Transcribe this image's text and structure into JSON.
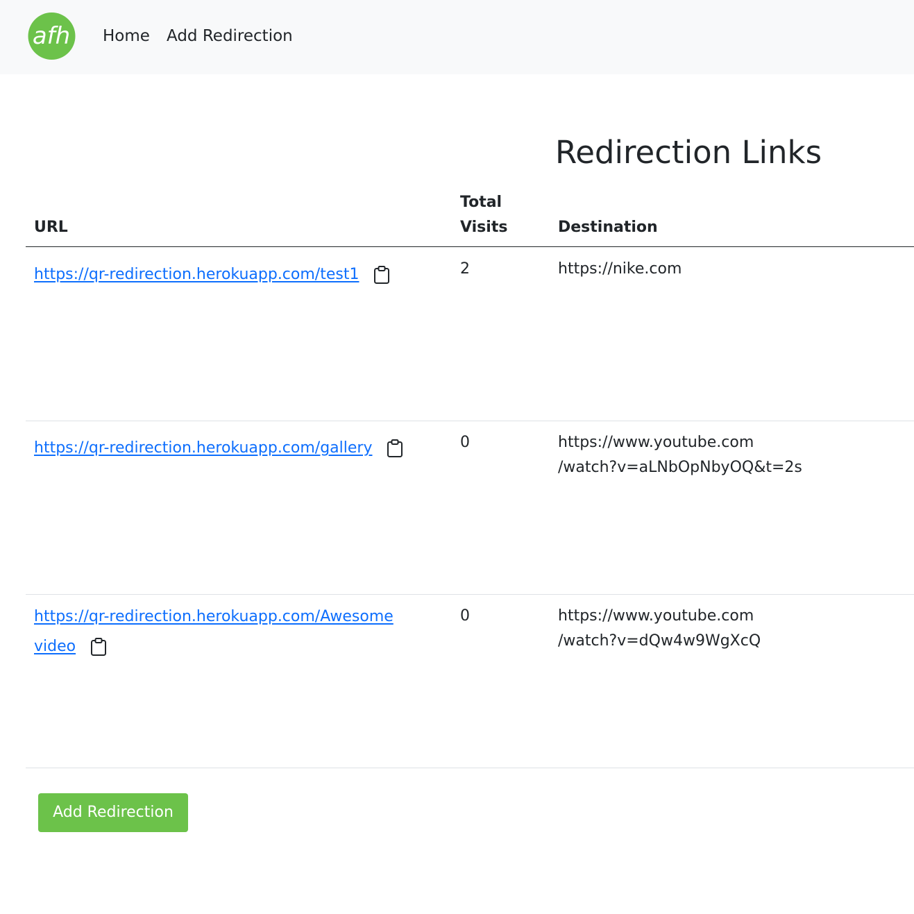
{
  "nav": {
    "logo_text": "afh",
    "home_label": "Home",
    "add_label": "Add Redirection"
  },
  "main": {
    "title": "Redirection Links",
    "columns": {
      "url": "URL",
      "visits_line1": "Total",
      "visits_line2": "Visits",
      "destination": "Destination"
    },
    "rows": [
      {
        "url": "https://qr-redirection.herokuapp.com/test1",
        "visits": "2",
        "destination": "https://nike.com"
      },
      {
        "url": "https://qr-redirection.herokuapp.com/gallery",
        "visits": "0",
        "destination": "https://www.youtube.com\n/watch?v=aLNbOpNbyOQ&t=2s"
      },
      {
        "url_line1": "https://qr-redirection.herokuapp.com/Awesome",
        "url_line2": "video",
        "visits": "0",
        "destination": "https://www.youtube.com\n/watch?v=dQw4w9WgXcQ"
      }
    ],
    "add_button_label": "Add Redirection"
  },
  "colors": {
    "brand_green": "#6cc24a",
    "link_blue": "#0d6efd",
    "navbar_bg": "#f8f9fa"
  },
  "icons": {
    "logo": "afh-logo",
    "copy": "clipboard-icon"
  }
}
